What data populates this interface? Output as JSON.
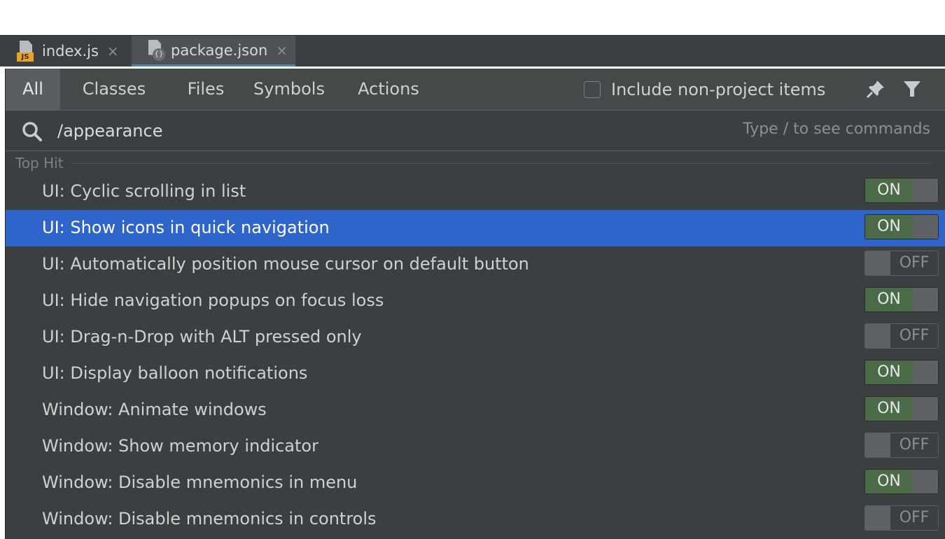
{
  "editor_tabs": [
    {
      "label": "index.js",
      "icon": "js-file-icon",
      "active": false
    },
    {
      "label": "package.json",
      "icon": "json-file-icon",
      "active": true
    }
  ],
  "popup": {
    "scope_tabs": [
      {
        "label": "All",
        "selected": true
      },
      {
        "label": "Classes",
        "selected": false
      },
      {
        "label": "Files",
        "selected": false
      },
      {
        "label": "Symbols",
        "selected": false
      },
      {
        "label": "Actions",
        "selected": false
      }
    ],
    "include_non_project": {
      "label": "Include non-project items",
      "checked": false
    },
    "toolbar_icons": [
      "pin-icon",
      "filter-icon"
    ],
    "search": {
      "value": "/appearance",
      "hint": "Type / to see commands"
    },
    "group_header": "Top Hit",
    "results": [
      {
        "label": "UI: Cyclic scrolling in list",
        "state": "ON",
        "selected": false
      },
      {
        "label": "UI: Show icons in quick navigation",
        "state": "ON",
        "selected": true
      },
      {
        "label": "UI: Automatically position mouse cursor on default button",
        "state": "OFF",
        "selected": false
      },
      {
        "label": "UI: Hide navigation popups on focus loss",
        "state": "ON",
        "selected": false
      },
      {
        "label": "UI: Drag-n-Drop with ALT pressed only",
        "state": "OFF",
        "selected": false
      },
      {
        "label": "UI: Display balloon notifications",
        "state": "ON",
        "selected": false
      },
      {
        "label": "Window: Animate windows",
        "state": "ON",
        "selected": false
      },
      {
        "label": "Window: Show memory indicator",
        "state": "OFF",
        "selected": false
      },
      {
        "label": "Window: Disable mnemonics in  menu",
        "state": "ON",
        "selected": false
      },
      {
        "label": "Window: Disable mnemonics in controls",
        "state": "OFF",
        "selected": false
      }
    ]
  },
  "colors": {
    "background": "#3c3f41",
    "scope_bar": "#45494a",
    "selection": "#2f65ca",
    "toggle_on": "#4b6a48",
    "tab_underline": "#4a88a6",
    "js_badge": "#e9a427"
  }
}
